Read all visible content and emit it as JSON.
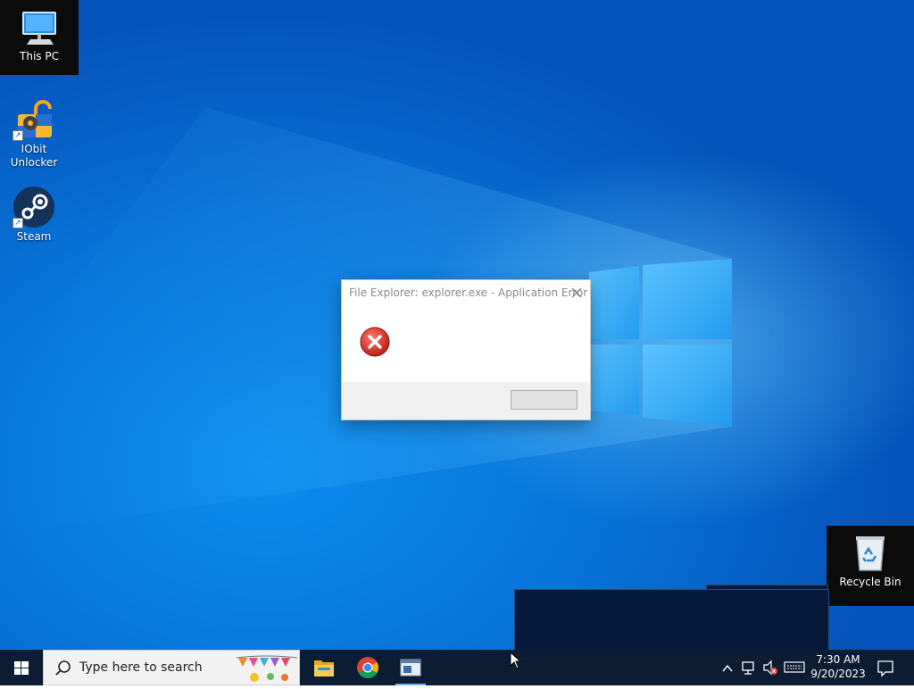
{
  "desktop": {
    "icons": [
      {
        "label": "This PC",
        "icon": "monitor-icon",
        "selected": true
      },
      {
        "label": "IObit Unlocker",
        "icon": "unlock-gear-icon",
        "selected": false
      },
      {
        "label": "Steam",
        "icon": "steam-icon",
        "selected": false
      },
      {
        "label": "Recycle Bin",
        "icon": "recycle-bin-icon",
        "selected": true
      }
    ]
  },
  "dialog": {
    "title": "File Explorer: explorer.exe - Application Error",
    "icon": "error-icon",
    "ok_label": ""
  },
  "taskbar": {
    "search_placeholder": "Type here to search",
    "apps": [
      {
        "name": "File Explorer",
        "icon": "folder-icon"
      },
      {
        "name": "Google Chrome",
        "icon": "chrome-icon"
      },
      {
        "name": "Application window",
        "icon": "window-icon"
      }
    ],
    "tray_icons": [
      "chevron-up-icon",
      "network-icon",
      "volume-muted-icon",
      "keyboard-icon"
    ],
    "time": "7:30 AM",
    "date": "9/20/2023"
  },
  "colors": {
    "taskbar": "#0c1c33",
    "desktop_accent": "#0a8ef0",
    "error_red": "#c42b1c"
  }
}
